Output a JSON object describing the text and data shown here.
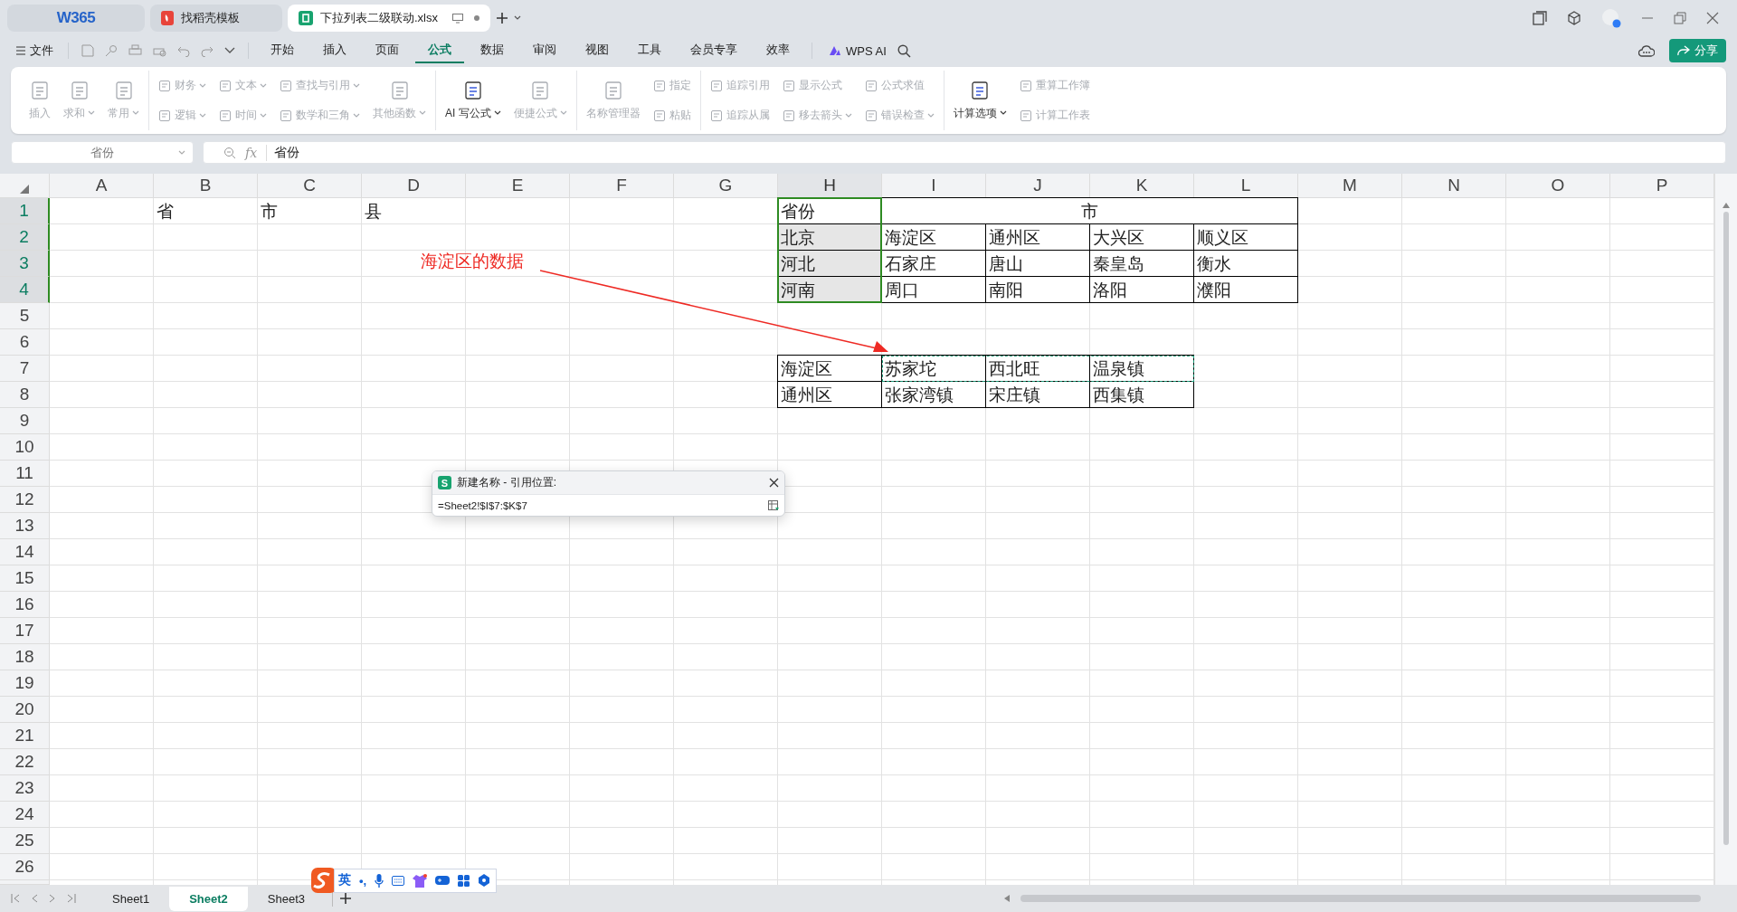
{
  "app_tabs": [
    {
      "label": "W365",
      "kind": "home",
      "selected": false
    },
    {
      "label": "找稻壳模板",
      "kind": "doc",
      "selected": false
    },
    {
      "label": "下拉列表二级联动.xlsx",
      "kind": "sheet",
      "selected": true
    }
  ],
  "menu": {
    "file": "文件",
    "tabs": [
      {
        "label": "开始",
        "selected": false
      },
      {
        "label": "插入",
        "selected": false
      },
      {
        "label": "页面",
        "selected": false
      },
      {
        "label": "公式",
        "selected": true
      },
      {
        "label": "数据",
        "selected": false
      },
      {
        "label": "审阅",
        "selected": false
      },
      {
        "label": "视图",
        "selected": false
      },
      {
        "label": "工具",
        "selected": false
      },
      {
        "label": "会员专享",
        "selected": false
      },
      {
        "label": "效率",
        "selected": false
      }
    ],
    "ai": "WPS AI",
    "share": "分享"
  },
  "ribbon": [
    {
      "items": [
        {
          "kind": "large",
          "label": "插入",
          "disabled": true,
          "dropdown": false
        },
        {
          "kind": "large",
          "label": "求和",
          "disabled": true,
          "dropdown": true
        },
        {
          "kind": "large",
          "label": "常用",
          "disabled": true,
          "dropdown": true
        }
      ]
    },
    {
      "items": [
        {
          "kind": "small",
          "label": "财务",
          "disabled": true,
          "dropdown": true
        },
        {
          "kind": "small",
          "label": "逻辑",
          "disabled": true,
          "dropdown": true
        },
        {
          "kind": "small",
          "label": "文本",
          "disabled": true,
          "dropdown": true
        },
        {
          "kind": "small",
          "label": "时间",
          "disabled": true,
          "dropdown": true
        },
        {
          "kind": "small",
          "label": "查找与引用",
          "disabled": true,
          "dropdown": true
        },
        {
          "kind": "small",
          "label": "数学和三角",
          "disabled": true,
          "dropdown": true
        },
        {
          "kind": "large",
          "label": "其他函数",
          "disabled": true,
          "dropdown": true
        }
      ]
    },
    {
      "items": [
        {
          "kind": "large",
          "label": "AI 写公式",
          "disabled": false,
          "dropdown": true
        },
        {
          "kind": "large",
          "label": "便捷公式",
          "disabled": true,
          "dropdown": true
        }
      ]
    },
    {
      "items": [
        {
          "kind": "large",
          "label": "名称管理器",
          "disabled": true,
          "dropdown": false
        },
        {
          "kind": "small",
          "label": "指定",
          "disabled": true,
          "dropdown": false
        },
        {
          "kind": "small",
          "label": "粘贴",
          "disabled": true,
          "dropdown": false
        }
      ]
    },
    {
      "items": [
        {
          "kind": "small",
          "label": "追踪引用",
          "disabled": true,
          "dropdown": false
        },
        {
          "kind": "small",
          "label": "追踪从属",
          "disabled": true,
          "dropdown": false
        },
        {
          "kind": "small",
          "label": "显示公式",
          "disabled": true,
          "dropdown": false
        },
        {
          "kind": "small",
          "label": "移去箭头",
          "disabled": true,
          "dropdown": true
        },
        {
          "kind": "small",
          "label": "公式求值",
          "disabled": true,
          "dropdown": false
        },
        {
          "kind": "small",
          "label": "错误检查",
          "disabled": true,
          "dropdown": true
        }
      ]
    },
    {
      "items": [
        {
          "kind": "large",
          "label": "计算选项",
          "disabled": false,
          "dropdown": true
        },
        {
          "kind": "small",
          "label": "重算工作簿",
          "disabled": true,
          "dropdown": false
        },
        {
          "kind": "small",
          "label": "计算工作表",
          "disabled": true,
          "dropdown": false
        }
      ]
    }
  ],
  "formula_bar": {
    "name_box": "省份",
    "fx": "fx",
    "content": "省份"
  },
  "sheet": {
    "columns": [
      {
        "label": "A",
        "selected": false
      },
      {
        "label": "B",
        "selected": false
      },
      {
        "label": "C",
        "selected": false
      },
      {
        "label": "D",
        "selected": false
      },
      {
        "label": "E",
        "selected": false
      },
      {
        "label": "F",
        "selected": false
      },
      {
        "label": "G",
        "selected": false
      },
      {
        "label": "H",
        "selected": true
      },
      {
        "label": "I",
        "selected": false
      },
      {
        "label": "J",
        "selected": false
      },
      {
        "label": "K",
        "selected": false
      },
      {
        "label": "L",
        "selected": false
      },
      {
        "label": "M",
        "selected": false
      },
      {
        "label": "N",
        "selected": false
      },
      {
        "label": "O",
        "selected": false
      },
      {
        "label": "P",
        "selected": false
      }
    ],
    "rows": [
      {
        "label": "1",
        "selected": true
      },
      {
        "label": "2",
        "selected": true
      },
      {
        "label": "3",
        "selected": true
      },
      {
        "label": "4",
        "selected": true
      },
      {
        "label": "5",
        "selected": false
      },
      {
        "label": "6",
        "selected": false
      },
      {
        "label": "7",
        "selected": false
      },
      {
        "label": "8",
        "selected": false
      },
      {
        "label": "9",
        "selected": false
      },
      {
        "label": "10",
        "selected": false
      },
      {
        "label": "11",
        "selected": false
      },
      {
        "label": "12",
        "selected": false
      },
      {
        "label": "13",
        "selected": false
      },
      {
        "label": "14",
        "selected": false
      },
      {
        "label": "15",
        "selected": false
      },
      {
        "label": "16",
        "selected": false
      },
      {
        "label": "17",
        "selected": false
      },
      {
        "label": "18",
        "selected": false
      },
      {
        "label": "19",
        "selected": false
      },
      {
        "label": "20",
        "selected": false
      },
      {
        "label": "21",
        "selected": false
      },
      {
        "label": "22",
        "selected": false
      },
      {
        "label": "23",
        "selected": false
      },
      {
        "label": "24",
        "selected": false
      },
      {
        "label": "25",
        "selected": false
      },
      {
        "label": "26",
        "selected": false
      }
    ],
    "labels": [
      "省",
      "市",
      "县"
    ],
    "province_table": {
      "header": {
        "province": "省份",
        "city": "市",
        "selected": true
      },
      "rows": [
        {
          "province": "北京",
          "selected": true,
          "cities": [
            "海淀区",
            "通州区",
            "大兴区",
            "顺义区"
          ]
        },
        {
          "province": "河北",
          "selected": true,
          "cities": [
            "石家庄",
            "唐山",
            "秦皇岛",
            "衡水"
          ]
        },
        {
          "province": "河南",
          "selected": true,
          "cities": [
            "周口",
            "南阳",
            "洛阳",
            "濮阳"
          ]
        }
      ]
    },
    "district_table": {
      "rows": [
        {
          "district": "海淀区",
          "towns": [
            {
              "text": "苏家坨",
              "copied": true
            },
            {
              "text": "西北旺",
              "copied": true
            },
            {
              "text": "温泉镇",
              "copied": true
            }
          ]
        },
        {
          "district": "通州区",
          "towns": [
            {
              "text": "张家湾镇",
              "copied": false
            },
            {
              "text": "宋庄镇",
              "copied": false
            },
            {
              "text": "西集镇",
              "copied": false
            }
          ]
        }
      ]
    },
    "annotation": {
      "text": "海淀区的数据"
    }
  },
  "dialog": {
    "title": "新建名称 - 引用位置:",
    "app_badge": "S",
    "value": "=Sheet2!$I$7:$K$7"
  },
  "sheet_tabs": [
    {
      "label": "Sheet1",
      "selected": false
    },
    {
      "label": "Sheet2",
      "selected": true
    },
    {
      "label": "Sheet3",
      "selected": false
    }
  ],
  "ime": {
    "mode": "英",
    "punct": "•,"
  }
}
